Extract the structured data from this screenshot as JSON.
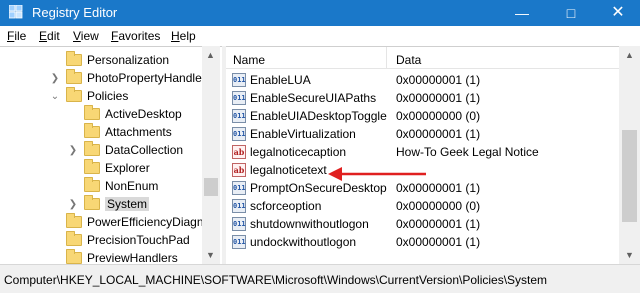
{
  "window": {
    "title": "Registry Editor",
    "minimize_icon": "minimize-icon",
    "maximize_icon": "maximize-icon",
    "close_icon": "close-icon"
  },
  "menu": [
    {
      "label": "File",
      "mnemonic": "F",
      "rest": "ile"
    },
    {
      "label": "Edit",
      "mnemonic": "E",
      "rest": "dit"
    },
    {
      "label": "View",
      "mnemonic": "V",
      "rest": "iew"
    },
    {
      "label": "Favorites",
      "mnemonic": "F",
      "rest": "avorites"
    },
    {
      "label": "Help",
      "mnemonic": "H",
      "rest": "elp"
    }
  ],
  "tree": [
    {
      "label": "Personalization",
      "expandable": false
    },
    {
      "label": "PhotoPropertyHandler",
      "expandable": true
    },
    {
      "label": "Policies",
      "expandable": true,
      "expanded": true
    },
    {
      "label": "ActiveDesktop",
      "expandable": false
    },
    {
      "label": "Attachments",
      "expandable": false
    },
    {
      "label": "DataCollection",
      "expandable": true
    },
    {
      "label": "Explorer",
      "expandable": false
    },
    {
      "label": "NonEnum",
      "expandable": false
    },
    {
      "label": "System",
      "expandable": true,
      "selected": true
    },
    {
      "label": "PowerEfficiencyDiagnc",
      "expandable": false
    },
    {
      "label": "PrecisionTouchPad",
      "expandable": false
    },
    {
      "label": "PreviewHandlers",
      "expandable": false
    }
  ],
  "columns": {
    "name": "Name",
    "data": "Data"
  },
  "values": [
    {
      "name": "EnableLUA",
      "type": "dword",
      "data": "0x00000001 (1)"
    },
    {
      "name": "EnableSecureUIAPaths",
      "type": "dword",
      "data": "0x00000001 (1)"
    },
    {
      "name": "EnableUIADesktopToggle",
      "type": "dword",
      "data": "0x00000000 (0)"
    },
    {
      "name": "EnableVirtualization",
      "type": "dword",
      "data": "0x00000001 (1)"
    },
    {
      "name": "legalnoticecaption",
      "type": "string",
      "data": "How-To Geek Legal Notice"
    },
    {
      "name": "legalnoticetext",
      "type": "string",
      "data": ""
    },
    {
      "name": "PromptOnSecureDesktop",
      "type": "dword",
      "data": "0x00000001 (1)"
    },
    {
      "name": "scforceoption",
      "type": "dword",
      "data": "0x00000000 (0)"
    },
    {
      "name": "shutdownwithoutlogon",
      "type": "dword",
      "data": "0x00000001 (1)"
    },
    {
      "name": "undockwithoutlogon",
      "type": "dword",
      "data": "0x00000001 (1)"
    }
  ],
  "string_icon_text": "ab",
  "dword_icon_text": "011",
  "annotation_color": "#e02020",
  "statusbar": {
    "path": "Computer\\HKEY_LOCAL_MACHINE\\SOFTWARE\\Microsoft\\Windows\\CurrentVersion\\Policies\\System"
  }
}
